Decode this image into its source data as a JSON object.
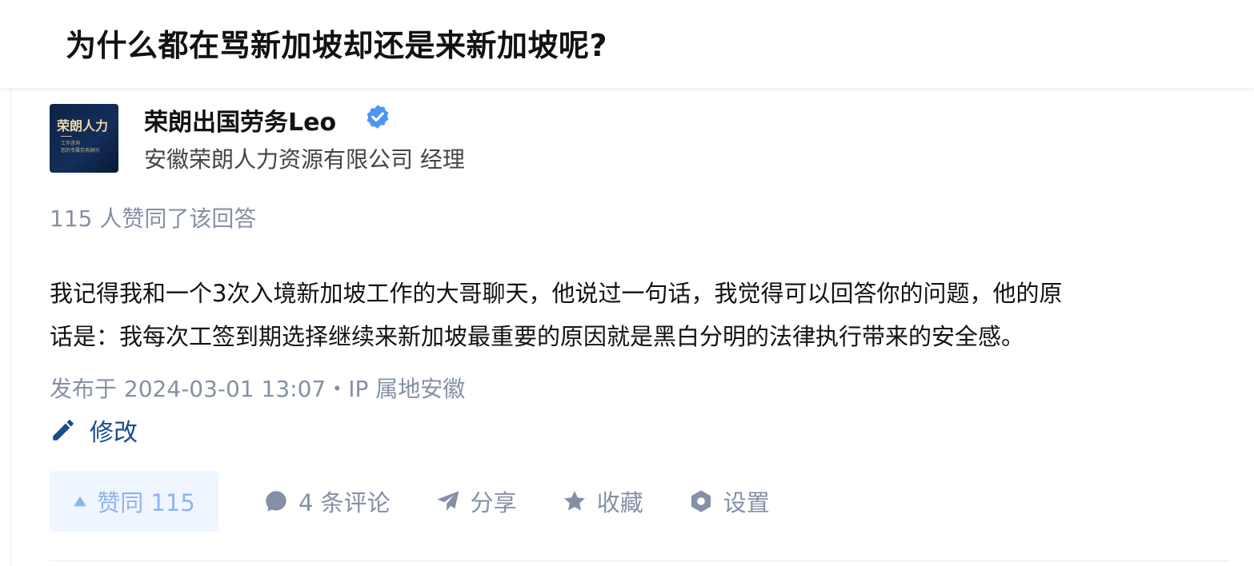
{
  "question": {
    "title": "为什么都在骂新加坡却还是来新加坡呢?"
  },
  "author": {
    "name": "荣朗出国劳务Leo",
    "headline": "安徽荣朗人力资源有限公司 经理",
    "avatar_text": "荣朗人力",
    "avatar_sub1": "工作咨询",
    "avatar_sub2": "您的专属劳务顾问",
    "verified_icon": "verified-badge-icon"
  },
  "answer": {
    "vote_summary": "115 人赞同了该回答",
    "body_lines": [
      "我记得我和一个3次入境新加坡工作的大哥聊天，他说过一句话，我觉得可以回答你的问题，他的原",
      "话是：我每次工签到期选择继续来新加坡最重要的原因就是黑白分明的法律执行带来的安全感。"
    ],
    "meta": "发布于 2024-03-01 13:07・IP 属地安徽",
    "edit_label": "修改"
  },
  "actions": {
    "vote": "赞同 115",
    "comments": "4 条评论",
    "share": "分享",
    "collect": "收藏",
    "settings": "设置"
  },
  "colors": {
    "primary_blue": "#1a4b8c",
    "vote_bg": "#eff6ff",
    "vote_text": "#8fb3ee",
    "muted": "#8590a6",
    "verified": "#4d94f5"
  }
}
